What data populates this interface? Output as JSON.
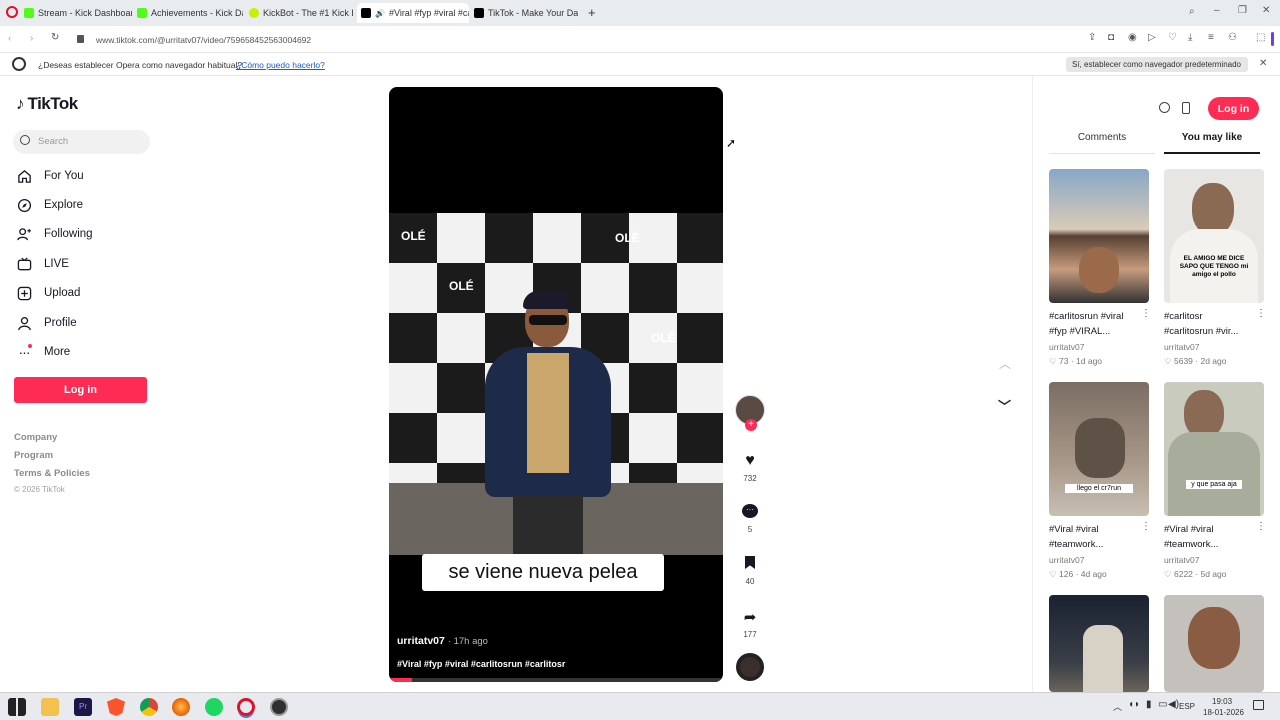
{
  "browser": {
    "tabs": [
      {
        "label": "Stream - Kick Dashboard",
        "color": "#53fc18"
      },
      {
        "label": "Achievements - Kick Dash",
        "color": "#53fc18"
      },
      {
        "label": "KickBot - The #1 Kick Bot",
        "color": "#c8f000"
      },
      {
        "label": "#Viral #fyp #viral #ca",
        "color": "#000000"
      },
      {
        "label": "TikTok - Make Your Day",
        "color": "#000000"
      }
    ],
    "url": "www.tiktok.com/@urritatv07/video/759658452563004692",
    "infobar": {
      "message": "¿Deseas establecer Opera como navegador habitual?",
      "link": "¿Cómo puedo hacerlo?",
      "button": "Sí, establecer como navegador predeterminado"
    }
  },
  "sidebar": {
    "logo": "TikTok",
    "search_placeholder": "Search",
    "items": [
      "For You",
      "Explore",
      "Following",
      "LIVE",
      "Upload",
      "Profile",
      "More"
    ],
    "login": "Log in",
    "footer": [
      "Company",
      "Program",
      "Terms & Policies",
      "© 2026 TikTok"
    ]
  },
  "video": {
    "caption_overlay": "se viene nueva pelea",
    "author": "urritatv07",
    "time": "· 17h ago",
    "hashtags": "#Viral #fyp #viral #carlitosrun #carlitosr",
    "backdrop_brand": "OLÉ",
    "progress": 0.07
  },
  "actions": {
    "likes": "732",
    "comments": "5",
    "saves": "40",
    "shares": "177"
  },
  "header": {
    "login": "Log in"
  },
  "panel": {
    "tabs": [
      "Comments",
      "You may like"
    ],
    "active_tab": "You may like",
    "items": [
      {
        "caption1": "#carlitosrun #viral",
        "caption2": "#fyp #VIRAL...",
        "user": "urritatv07",
        "likes": "73",
        "age": "· 1d ago",
        "overlay": ""
      },
      {
        "caption1": "#carlitosr",
        "caption2": "#carlitosrun #vir...",
        "user": "urritatv07",
        "likes": "5639",
        "age": "· 2d ago",
        "overlay": "EL AMIGO ME DICE SAPO QUE TENGO mi amigo el pollo"
      },
      {
        "caption1": "#Viral #viral",
        "caption2": "#teamwork...",
        "user": "urritatv07",
        "likes": "126",
        "age": "· 4d ago",
        "overlay": "llego el cr7run"
      },
      {
        "caption1": "#Viral #viral",
        "caption2": "#teamwork...",
        "user": "urritatv07",
        "likes": "6222",
        "age": "· 5d ago",
        "overlay": "y que pasa aja"
      },
      {
        "caption1": "",
        "caption2": "",
        "user": "",
        "likes": "",
        "age": "",
        "overlay": ""
      },
      {
        "caption1": "",
        "caption2": "",
        "user": "",
        "likes": "",
        "age": "",
        "overlay": ""
      }
    ]
  },
  "taskbar": {
    "lang": "ESP",
    "time": "19:03",
    "date": "18-01-2026"
  },
  "colors": {
    "accent": "#fe2c55"
  }
}
